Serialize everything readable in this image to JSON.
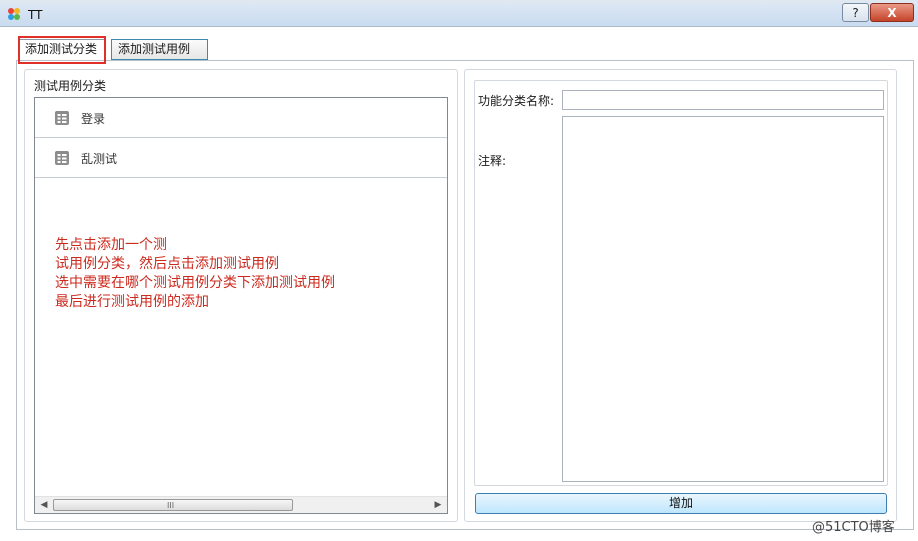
{
  "window": {
    "title": "TT",
    "help_label": "?",
    "close_label": "X"
  },
  "tabs": [
    {
      "label": "添加测试分类",
      "selected": true
    },
    {
      "label": "添加测试用例",
      "selected": false
    }
  ],
  "left_panel": {
    "title": "测试用例分类",
    "items": [
      {
        "label": "登录"
      },
      {
        "label": "乱测试"
      }
    ],
    "note_lines": [
      "先点击添加一个测",
      "试用例分类，然后点击添加测试用例",
      "选中需要在哪个测试用例分类下添加测试用例",
      "最后进行测试用例的添加"
    ],
    "note_color": "#cc2a1e",
    "scroll": {
      "left_arrow": "◀",
      "right_arrow": "▶",
      "grip": "III"
    }
  },
  "form": {
    "name_label": "功能分类名称:",
    "name_value": "",
    "comment_label": "注释:",
    "comment_value": "",
    "add_button": "增加"
  },
  "watermark": "@51CTO博客"
}
